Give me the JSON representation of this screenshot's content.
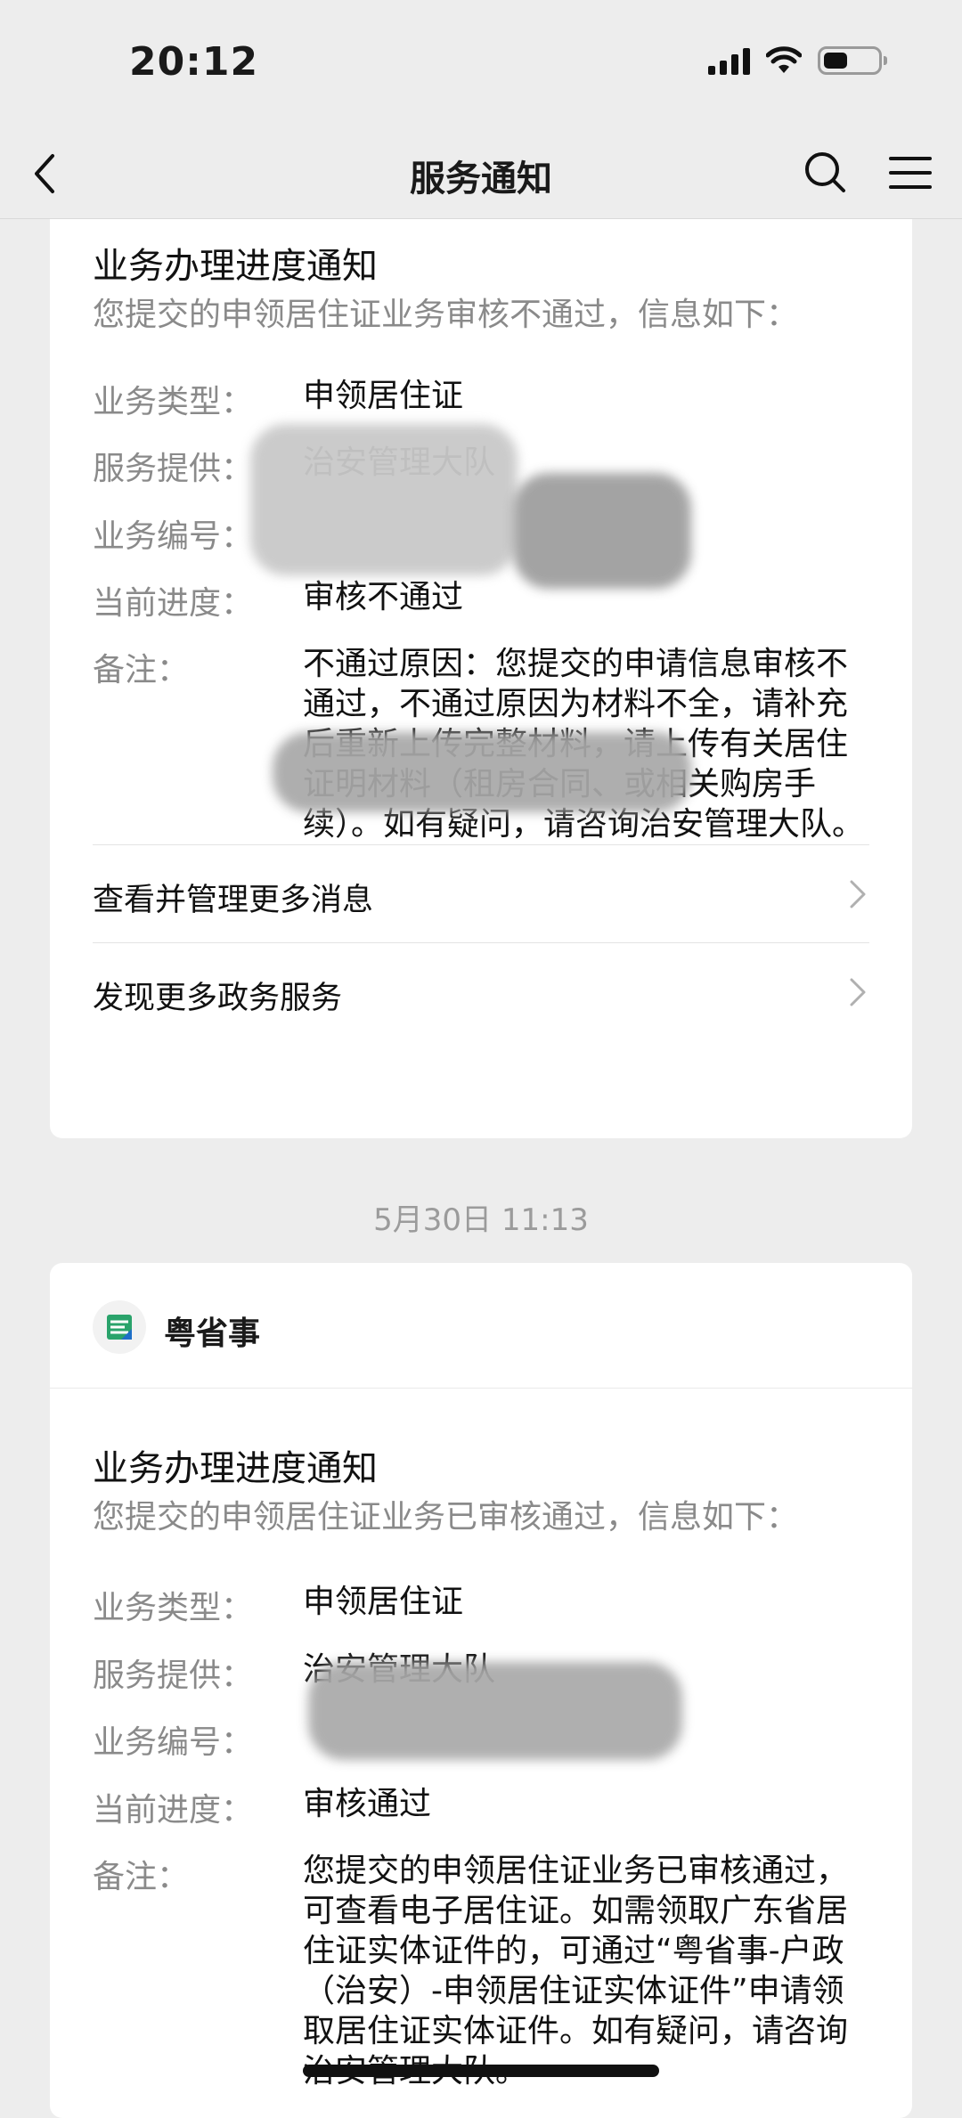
{
  "status_bar": {
    "time": "20:12"
  },
  "nav": {
    "title": "服务通知"
  },
  "card1": {
    "title": "业务办理进度通知",
    "subtitle": "您提交的申领居住证业务审核不通过，信息如下：",
    "rows": [
      {
        "label": "业务类型：",
        "value": "申领居住证"
      },
      {
        "label": "服务提供：",
        "value": "治安管理大队"
      },
      {
        "label": "业务编号：",
        "value": ""
      },
      {
        "label": "当前进度：",
        "value": "审核不通过"
      },
      {
        "label": "备注：",
        "value": "不通过原因：您提交的申请信息审核不通过，不通过原因为材料不全，请补充后重新上传完整材料，请上传有关居住证明材料（租房合同、或相关购房手续）。如有疑问，请咨询治安管理大队。"
      }
    ],
    "links": [
      {
        "label": "查看并管理更多消息"
      },
      {
        "label": "发现更多政务服务"
      }
    ]
  },
  "timestamp": "5月30日 11:13",
  "card2": {
    "brand": "粤省事",
    "title": "业务办理进度通知",
    "subtitle": "您提交的申领居住证业务已审核通过，信息如下：",
    "rows": [
      {
        "label": "业务类型：",
        "value": "申领居住证"
      },
      {
        "label": "服务提供：",
        "value": "治安管理大队"
      },
      {
        "label": "业务编号：",
        "value": ""
      },
      {
        "label": "当前进度：",
        "value": "审核通过"
      },
      {
        "label": "备注：",
        "value": "您提交的申领居住证业务已审核通过，可查看电子居住证。如需领取广东省居住证实体证件的，可通过“粤省事-户政（治安）-申领居住证实体证件”申请领取居住证实体证件。如有疑问，请咨询治安管理大队。"
      }
    ]
  }
}
